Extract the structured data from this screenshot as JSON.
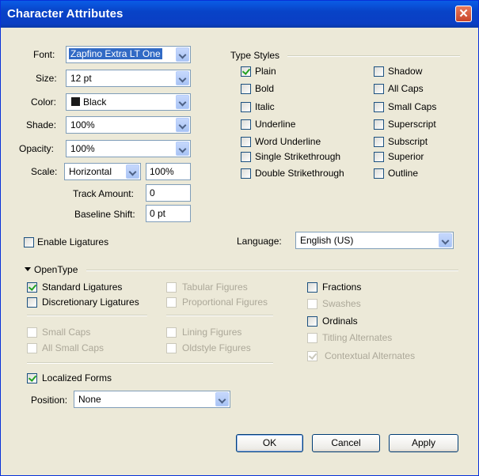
{
  "window": {
    "title": "Character Attributes",
    "close_glyph": "✕"
  },
  "font": {
    "label": "Font:",
    "value": "Zapfino Extra LT One"
  },
  "size": {
    "label": "Size:",
    "value": "12 pt"
  },
  "color": {
    "label": "Color:",
    "value": "Black",
    "swatch": "#1a1a1a"
  },
  "shade": {
    "label": "Shade:",
    "value": "100%"
  },
  "opacity": {
    "label": "Opacity:",
    "value": "100%"
  },
  "scale": {
    "label": "Scale:",
    "mode": "Horizontal",
    "value": "100%"
  },
  "track": {
    "label": "Track Amount:",
    "value": "0"
  },
  "baseline": {
    "label": "Baseline Shift:",
    "value": "0 pt"
  },
  "type_styles": {
    "heading": "Type Styles",
    "left": [
      {
        "label": "Plain",
        "checked": true
      },
      {
        "label": "Bold",
        "checked": false
      },
      {
        "label": "Italic",
        "checked": false
      },
      {
        "label": "Underline",
        "checked": false
      },
      {
        "label": "Word Underline",
        "checked": false
      },
      {
        "label": "Single Strikethrough",
        "checked": false
      },
      {
        "label": "Double Strikethrough",
        "checked": false
      }
    ],
    "right": [
      {
        "label": "Shadow",
        "checked": false
      },
      {
        "label": "All Caps",
        "checked": false
      },
      {
        "label": "Small Caps",
        "checked": false
      },
      {
        "label": "Superscript",
        "checked": false
      },
      {
        "label": "Subscript",
        "checked": false
      },
      {
        "label": "Superior",
        "checked": false
      },
      {
        "label": "Outline",
        "checked": false
      }
    ]
  },
  "ligatures": {
    "label": "Enable Ligatures",
    "checked": false
  },
  "language": {
    "label": "Language:",
    "value": "English (US)"
  },
  "opentype": {
    "heading": "OpenType",
    "standard_ligatures": {
      "label": "Standard Ligatures",
      "checked": true
    },
    "discretionary_ligatures": {
      "label": "Discretionary Ligatures",
      "checked": false
    },
    "small_caps": {
      "label": "Small Caps",
      "checked": false,
      "disabled": true
    },
    "all_small_caps": {
      "label": "All Small Caps",
      "checked": false,
      "disabled": true
    },
    "tabular_figures": {
      "label": "Tabular Figures",
      "checked": false,
      "disabled": true
    },
    "proportional_figures": {
      "label": "Proportional Figures",
      "checked": false,
      "disabled": true
    },
    "lining_figures": {
      "label": "Lining Figures",
      "checked": false,
      "disabled": true
    },
    "oldstyle_figures": {
      "label": "Oldstyle Figures",
      "checked": false,
      "disabled": true
    },
    "fractions": {
      "label": "Fractions",
      "checked": false
    },
    "swashes": {
      "label": "Swashes",
      "checked": false,
      "disabled": true
    },
    "ordinals": {
      "label": "Ordinals",
      "checked": false
    },
    "titling_alternates": {
      "label": "Titling Alternates",
      "checked": false,
      "disabled": true
    },
    "contextual_alternates": {
      "label": "Contextual Alternates",
      "checked": true,
      "disabled": true
    },
    "localized_forms": {
      "label": "Localized Forms",
      "checked": true
    },
    "position": {
      "label": "Position:",
      "value": "None"
    }
  },
  "buttons": {
    "ok": "OK",
    "cancel": "Cancel",
    "apply": "Apply"
  }
}
